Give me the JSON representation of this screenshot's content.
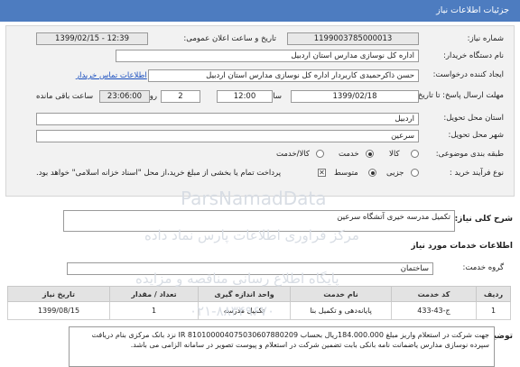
{
  "header": {
    "title": "جزئیات اطلاعات نیاز"
  },
  "form": {
    "need_number_label": "شماره نیاز:",
    "need_number": "1199003785000013",
    "announce_label": "تاریخ و ساعت اعلان عمومی:",
    "announce_value": "1399/02/15 - 12:39",
    "buyer_label": "نام دستگاه خریدار:",
    "buyer_value": "اداره کل نوسازی مدارس استان اردبیل",
    "requester_label": "ایجاد کننده درخواست:",
    "requester_value": "حسن ذاکرحمیدی کاربردار اداره کل نوسازی مدارس استان اردبیل",
    "contact_link": "اطلاعات تماس خریدار",
    "deadline_label": "مهلت ارسال پاسخ: تا تاریخ:",
    "deadline_date": "1399/02/18",
    "time_label": "ساعت",
    "deadline_time": "12:00",
    "days_value": "2",
    "days_label": "روز و",
    "remaining_time": "23:06:00",
    "remaining_label": "ساعت باقی مانده",
    "province_label": "استان محل تحویل:",
    "province_value": "اردبیل",
    "city_label": "شهر محل تحویل:",
    "city_value": "سرعین",
    "category_label": "طبقه بندی موضوعی:",
    "category_options": [
      "کالا",
      "خدمت",
      "کالا/خدمت"
    ],
    "category_selected": "خدمت",
    "process_label": "نوع فرآیند خرید :",
    "process_options": [
      "جزیی",
      "متوسط"
    ],
    "process_selected": "متوسط",
    "payment_note": "پرداخت تمام یا بخشی از مبلغ خرید،از محل \"اسناد خزانه اسلامی\" خواهد بود."
  },
  "summary": {
    "label": "شرح کلی نیاز:",
    "value": "تکمیل مدرسه خیری آتشگاه سرعین"
  },
  "services": {
    "section_title": "اطلاعات خدمات مورد نیاز",
    "group_label": "گروه خدمت:",
    "group_value": "ساختمان"
  },
  "table": {
    "headers": [
      "ردیف",
      "کد خدمت",
      "نام خدمت",
      "واحد اندازه گیری",
      "تعداد / مقدار",
      "تاریخ نیاز"
    ],
    "rows": [
      [
        "1",
        "ج-43-433",
        "پایانه‌دهی و تکمیل بنا",
        "تکمیل مدرسه",
        "1",
        "1399/08/15"
      ]
    ]
  },
  "buyer_notes": {
    "label": "توضیحات خریدار:",
    "text": "جهت شرکت در استعلام واریز مبلغ 184.000.000ریال بحساب IR 810100004075030607880209 نزد بانک مرکزی بنام دریافت سپرده نوسازی مدارس یاضمانت نامه بانکی بابت تضمین شرکت در استعلام و پیوست تصویر در سامانه الزامی می باشد."
  },
  "watermark": {
    "line1": "ParsNamadData",
    "line2": "مرکز فراوری اطلاعات پارس نماد داده",
    "line3": "پایگاه اطلاع رسانی مناقصه و مزایده",
    "line4": "۰۲۱-۸۸۳۴۹۶۷۰"
  },
  "colors": {
    "header_bg": "#4d7cc0",
    "link": "#1a4fbf"
  }
}
